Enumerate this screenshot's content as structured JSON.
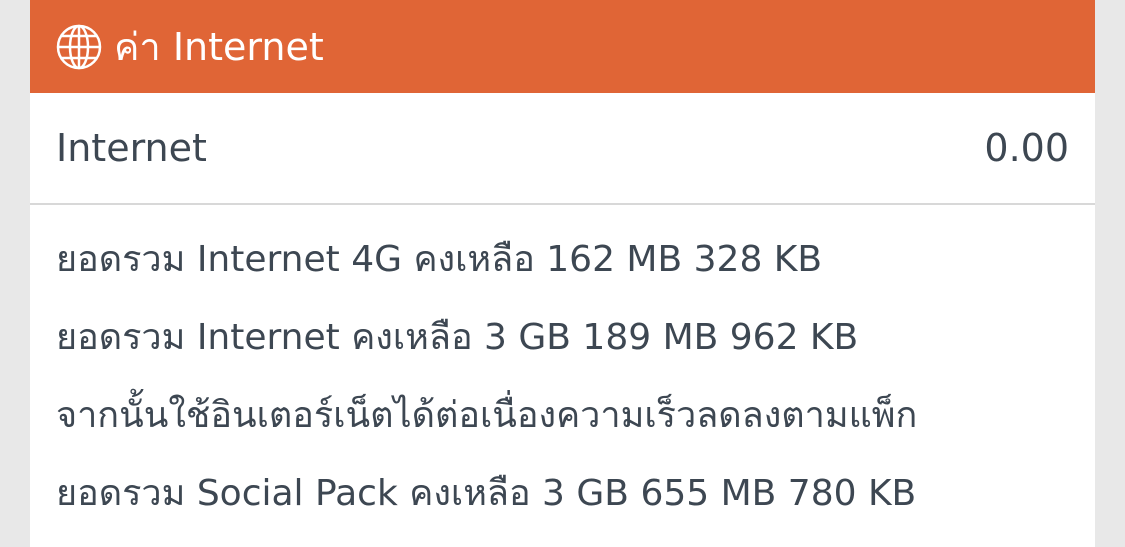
{
  "header": {
    "icon": "globe-icon",
    "title": "ค่า Internet",
    "background": "#e06536"
  },
  "usage_row": {
    "label": "Internet",
    "value": "0.00"
  },
  "details": [
    "ยอดรวม Internet 4G คงเหลือ 162 MB 328 KB",
    "ยอดรวม Internet คงเหลือ 3 GB 189 MB 962 KB",
    "จากนั้นใช้อินเตอร์เน็ตได้ต่อเนื่องความเร็วลดลงตามแพ็ก",
    "ยอดรวม Social Pack คงเหลือ 3 GB 655 MB 780 KB"
  ]
}
